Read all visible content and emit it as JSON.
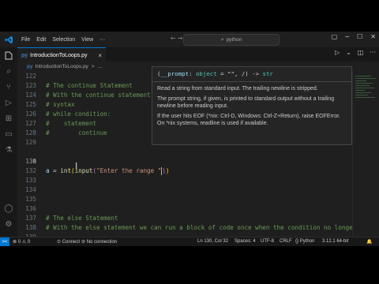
{
  "menu": [
    "File",
    "Edit",
    "Selection",
    "View",
    "···"
  ],
  "search": {
    "text": "python"
  },
  "tab": {
    "filename": "IntroductionToLoops.py"
  },
  "breadcrumb": {
    "filename": "IntroductionToLoops.py",
    "separator": ">",
    "symbol": "..."
  },
  "editor": {
    "lines": [
      {
        "num": "122",
        "text": ""
      },
      {
        "num": "123",
        "text": "# The continue Statement"
      },
      {
        "num": "124",
        "text": "# With the continue statement we can stop the current iteration, and continue with the n"
      },
      {
        "num": "125",
        "text": "# syntax"
      },
      {
        "num": "126",
        "text": "# while condition:"
      },
      {
        "num": "127",
        "text": "#    statement"
      },
      {
        "num": "128",
        "text": "#        continue"
      },
      {
        "num": "129",
        "text": ""
      },
      {
        "num": "130",
        "text": ""
      },
      {
        "num": "131",
        "text": ""
      },
      {
        "num": "132",
        "text": ""
      },
      {
        "num": "133",
        "text": ""
      },
      {
        "num": "134",
        "text": ""
      },
      {
        "num": "135",
        "text": ""
      },
      {
        "num": "136",
        "text": ""
      },
      {
        "num": "137",
        "text": "# The else Statement"
      },
      {
        "num": "138",
        "text": "# With the else statement we can run a block of code once when the condition no longer i"
      },
      {
        "num": "139",
        "text": ""
      },
      {
        "num": "140",
        "text": ""
      }
    ],
    "active_line": {
      "var": "a",
      "op": " = ",
      "fn1": "int",
      "br1": "(",
      "fn2": "input",
      "br2": "(",
      "str": "\"Enter the range \"",
      "br3": ")",
      "br4": ")"
    }
  },
  "hover": {
    "sig_open": "(",
    "param": "__prompt",
    "sig_mid": ": ",
    "type": "object",
    "sig_rest": " = \"\", /) -> ",
    "ret": "str",
    "p1": "Read a string from standard input. The trailing newline is stripped.",
    "p2": "The prompt string, if given, is printed to standard output without a trailing newline before reading input.",
    "p3": "If the user hits EOF (*nix: Ctrl-D, Windows: Ctrl-Z+Return), raise EOFError. On *nix systems, readline is used if available."
  },
  "statusbar": {
    "errors": "0",
    "warnings": "0",
    "connect": "Connect",
    "notification": "No connection",
    "position": "Ln 130, Col 32",
    "spaces": "Spaces: 4",
    "encoding": "UTF-8",
    "eol": "CRLF",
    "language": "Python",
    "interpreter": "3.12.1 64-bit"
  },
  "colors": {
    "accent": "#0078d4",
    "editor_bg": "#1f1f1f",
    "comment": "#6a9955",
    "string": "#ce9178",
    "function": "#dcdcaa"
  }
}
